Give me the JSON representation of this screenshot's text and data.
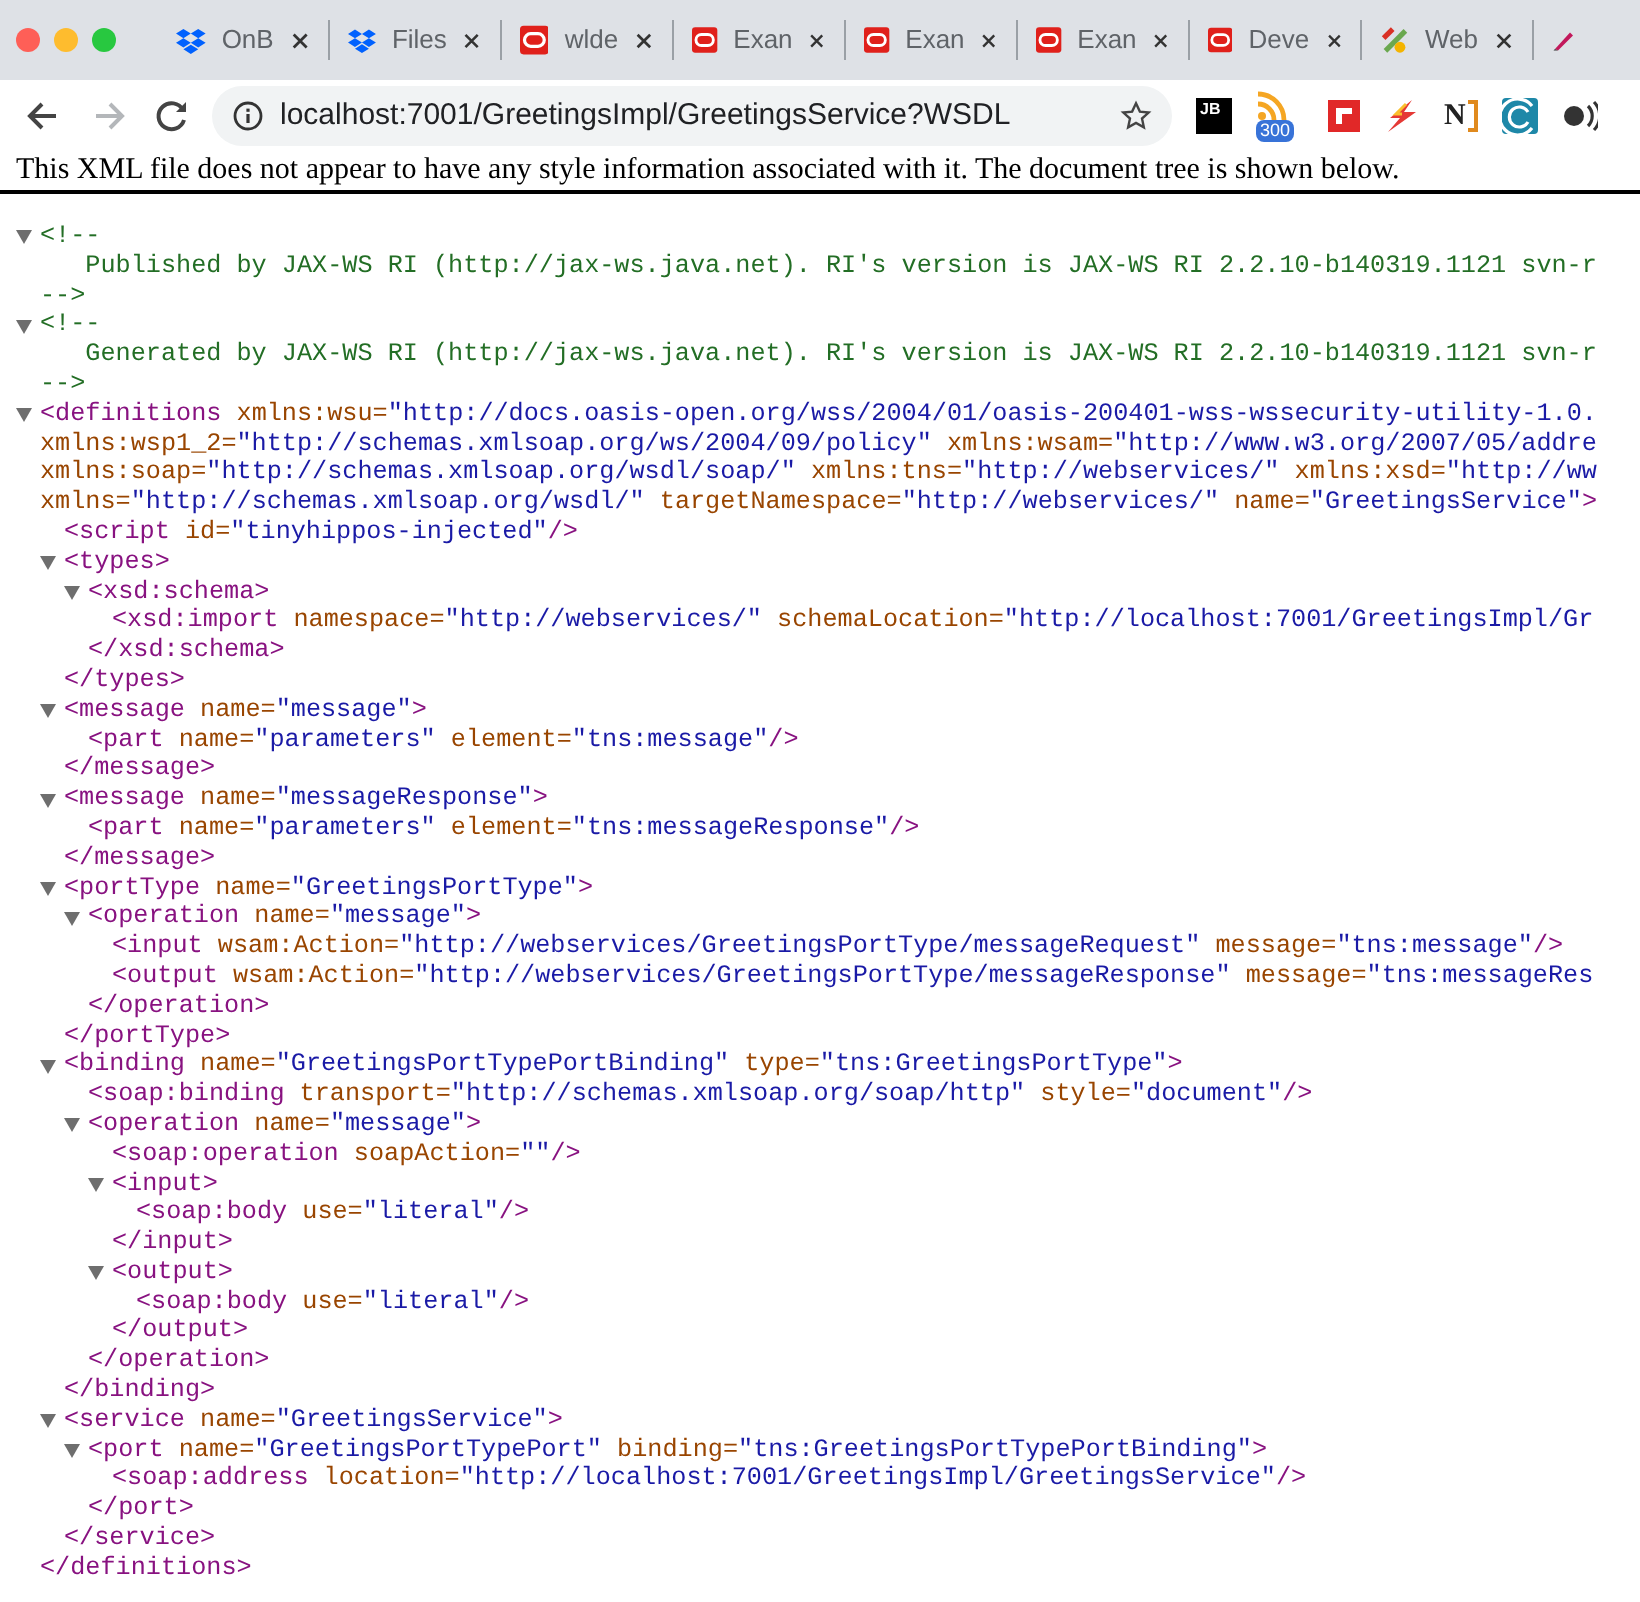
{
  "tabs": [
    {
      "kind": "dropbox",
      "title": "OnB",
      "selected": false
    },
    {
      "kind": "dropbox",
      "title": "Files",
      "selected": false
    },
    {
      "kind": "oracle",
      "title": "wlde",
      "selected": false
    },
    {
      "kind": "oracle",
      "title": "Exan",
      "selected": false
    },
    {
      "kind": "oracle",
      "title": "Exan",
      "selected": false
    },
    {
      "kind": "oracle",
      "title": "Exan",
      "selected": false
    },
    {
      "kind": "oracle",
      "title": "Deve",
      "selected": false
    },
    {
      "kind": "palette",
      "title": "Web",
      "selected": false
    },
    {
      "kind": "pen",
      "selected": false
    }
  ],
  "toolbar": {
    "buttons": [
      {
        "kind": "back",
        "disabled": false
      },
      {
        "kind": "forward",
        "disabled": true
      },
      {
        "kind": "reload",
        "disabled": false
      }
    ],
    "url": "localhost:7001/GreetingsImpl/GreetingsService?WSDL",
    "extensions": [
      {
        "kind": "jb",
        "label": "JB"
      },
      {
        "kind": "rss",
        "badge": "300"
      },
      {
        "kind": "flipboard"
      },
      {
        "kind": "bolt"
      },
      {
        "kind": "n",
        "label": "N"
      },
      {
        "kind": "wave"
      },
      {
        "kind": "broadcast"
      }
    ]
  },
  "info": "This XML file does not appear to have any style information associated with it. The document tree is shown below.",
  "document": [
    {
      "kind": "comment",
      "expanded": true,
      "lines": [
        "<!--",
        "   Published by JAX-WS RI (http://jax-ws.java.net). RI's version is JAX-WS RI 2.2.10-b140319.1121 svn-r",
        "-->"
      ]
    },
    {
      "kind": "comment",
      "expanded": true,
      "lines": [
        "<!--",
        "   Generated by JAX-WS RI (http://jax-ws.java.net). RI's version is JAX-WS RI 2.2.10-b140319.1121 svn-r",
        "-->"
      ]
    },
    {
      "kind": "element",
      "expanded": true,
      "open": [
        [
          {
            "kind": "tag",
            "text": "<definitions"
          },
          {
            "kind": "attr",
            "text": " xmlns:wsu="
          },
          {
            "kind": "value",
            "text": "\"http://docs.oasis-open.org/wss/2004/01/oasis-200401-wss-wssecurity-utility-1.0."
          }
        ],
        [
          {
            "kind": "attr",
            "text": "xmlns:wsp1_2="
          },
          {
            "kind": "value",
            "text": "\"http://schemas.xmlsoap.org/ws/2004/09/policy\""
          },
          {
            "kind": "attr",
            "text": " xmlns:wsam="
          },
          {
            "kind": "value",
            "text": "\"http://www.w3.org/2007/05/addre"
          }
        ],
        [
          {
            "kind": "attr",
            "text": "xmlns:soap="
          },
          {
            "kind": "value",
            "text": "\"http://schemas.xmlsoap.org/wsdl/soap/\""
          },
          {
            "kind": "attr",
            "text": " xmlns:tns="
          },
          {
            "kind": "value",
            "text": "\"http://webservices/\""
          },
          {
            "kind": "attr",
            "text": " xmlns:xsd="
          },
          {
            "kind": "value",
            "text": "\"http://ww"
          }
        ],
        [
          {
            "kind": "attr",
            "text": "xmlns="
          },
          {
            "kind": "value",
            "text": "\"http://schemas.xmlsoap.org/wsdl/\""
          },
          {
            "kind": "attr",
            "text": " targetNamespace="
          },
          {
            "kind": "value",
            "text": "\"http://webservices/\""
          },
          {
            "kind": "attr",
            "text": " name="
          },
          {
            "kind": "value",
            "text": "\"GreetingsService\""
          },
          {
            "kind": "tag",
            "text": ">"
          }
        ]
      ],
      "children": [
        {
          "kind": "element",
          "open": [
            [
              {
                "kind": "tag",
                "text": "<script"
              },
              {
                "kind": "attr",
                "text": " id="
              },
              {
                "kind": "value",
                "text": "\"tinyhippos-injected\""
              },
              {
                "kind": "tag",
                "text": "/>"
              }
            ]
          ]
        },
        {
          "kind": "element",
          "expanded": true,
          "open": [
            [
              {
                "kind": "tag",
                "text": "<types>"
              }
            ]
          ],
          "children": [
            {
              "kind": "element",
              "expanded": true,
              "open": [
                [
                  {
                    "kind": "tag",
                    "text": "<xsd:schema>"
                  }
                ]
              ],
              "children": [
                {
                  "kind": "element",
                  "open": [
                    [
                      {
                        "kind": "tag",
                        "text": "<xsd:import"
                      },
                      {
                        "kind": "attr",
                        "text": " namespace="
                      },
                      {
                        "kind": "value",
                        "text": "\"http://webservices/\""
                      },
                      {
                        "kind": "attr",
                        "text": " schemaLocation="
                      },
                      {
                        "kind": "value",
                        "text": "\"http://localhost:7001/GreetingsImpl/Gr"
                      }
                    ]
                  ]
                }
              ],
              "close": [
                {
                  "kind": "tag",
                  "text": "</xsd:schema>"
                }
              ]
            }
          ],
          "close": [
            {
              "kind": "tag",
              "text": "</types>"
            }
          ]
        },
        {
          "kind": "element",
          "expanded": true,
          "open": [
            [
              {
                "kind": "tag",
                "text": "<message"
              },
              {
                "kind": "attr",
                "text": " name="
              },
              {
                "kind": "value",
                "text": "\"message\""
              },
              {
                "kind": "tag",
                "text": ">"
              }
            ]
          ],
          "children": [
            {
              "kind": "element",
              "open": [
                [
                  {
                    "kind": "tag",
                    "text": "<part"
                  },
                  {
                    "kind": "attr",
                    "text": " name="
                  },
                  {
                    "kind": "value",
                    "text": "\"parameters\""
                  },
                  {
                    "kind": "attr",
                    "text": " element="
                  },
                  {
                    "kind": "value",
                    "text": "\"tns:message\""
                  },
                  {
                    "kind": "tag",
                    "text": "/>"
                  }
                ]
              ]
            }
          ],
          "close": [
            {
              "kind": "tag",
              "text": "</message>"
            }
          ]
        },
        {
          "kind": "element",
          "expanded": true,
          "open": [
            [
              {
                "kind": "tag",
                "text": "<message"
              },
              {
                "kind": "attr",
                "text": " name="
              },
              {
                "kind": "value",
                "text": "\"messageResponse\""
              },
              {
                "kind": "tag",
                "text": ">"
              }
            ]
          ],
          "children": [
            {
              "kind": "element",
              "open": [
                [
                  {
                    "kind": "tag",
                    "text": "<part"
                  },
                  {
                    "kind": "attr",
                    "text": " name="
                  },
                  {
                    "kind": "value",
                    "text": "\"parameters\""
                  },
                  {
                    "kind": "attr",
                    "text": " element="
                  },
                  {
                    "kind": "value",
                    "text": "\"tns:messageResponse\""
                  },
                  {
                    "kind": "tag",
                    "text": "/>"
                  }
                ]
              ]
            }
          ],
          "close": [
            {
              "kind": "tag",
              "text": "</message>"
            }
          ]
        },
        {
          "kind": "element",
          "expanded": true,
          "open": [
            [
              {
                "kind": "tag",
                "text": "<portType"
              },
              {
                "kind": "attr",
                "text": " name="
              },
              {
                "kind": "value",
                "text": "\"GreetingsPortType\""
              },
              {
                "kind": "tag",
                "text": ">"
              }
            ]
          ],
          "children": [
            {
              "kind": "element",
              "expanded": true,
              "open": [
                [
                  {
                    "kind": "tag",
                    "text": "<operation"
                  },
                  {
                    "kind": "attr",
                    "text": " name="
                  },
                  {
                    "kind": "value",
                    "text": "\"message\""
                  },
                  {
                    "kind": "tag",
                    "text": ">"
                  }
                ]
              ],
              "children": [
                {
                  "kind": "element",
                  "open": [
                    [
                      {
                        "kind": "tag",
                        "text": "<input"
                      },
                      {
                        "kind": "attr",
                        "text": " wsam:Action="
                      },
                      {
                        "kind": "value",
                        "text": "\"http://webservices/GreetingsPortType/messageRequest\""
                      },
                      {
                        "kind": "attr",
                        "text": " message="
                      },
                      {
                        "kind": "value",
                        "text": "\"tns:message\""
                      },
                      {
                        "kind": "tag",
                        "text": "/>"
                      }
                    ]
                  ]
                },
                {
                  "kind": "element",
                  "open": [
                    [
                      {
                        "kind": "tag",
                        "text": "<output"
                      },
                      {
                        "kind": "attr",
                        "text": " wsam:Action="
                      },
                      {
                        "kind": "value",
                        "text": "\"http://webservices/GreetingsPortType/messageResponse\""
                      },
                      {
                        "kind": "attr",
                        "text": " message="
                      },
                      {
                        "kind": "value",
                        "text": "\"tns:messageRes"
                      }
                    ]
                  ]
                }
              ],
              "close": [
                {
                  "kind": "tag",
                  "text": "</operation>"
                }
              ]
            }
          ],
          "close": [
            {
              "kind": "tag",
              "text": "</portType>"
            }
          ]
        },
        {
          "kind": "element",
          "expanded": true,
          "open": [
            [
              {
                "kind": "tag",
                "text": "<binding"
              },
              {
                "kind": "attr",
                "text": " name="
              },
              {
                "kind": "value",
                "text": "\"GreetingsPortTypePortBinding\""
              },
              {
                "kind": "attr",
                "text": " type="
              },
              {
                "kind": "value",
                "text": "\"tns:GreetingsPortType\""
              },
              {
                "kind": "tag",
                "text": ">"
              }
            ]
          ],
          "children": [
            {
              "kind": "element",
              "open": [
                [
                  {
                    "kind": "tag",
                    "text": "<soap:binding"
                  },
                  {
                    "kind": "attr",
                    "text": " transport="
                  },
                  {
                    "kind": "value",
                    "text": "\"http://schemas.xmlsoap.org/soap/http\""
                  },
                  {
                    "kind": "attr",
                    "text": " style="
                  },
                  {
                    "kind": "value",
                    "text": "\"document\""
                  },
                  {
                    "kind": "tag",
                    "text": "/>"
                  }
                ]
              ]
            },
            {
              "kind": "element",
              "expanded": true,
              "open": [
                [
                  {
                    "kind": "tag",
                    "text": "<operation"
                  },
                  {
                    "kind": "attr",
                    "text": " name="
                  },
                  {
                    "kind": "value",
                    "text": "\"message\""
                  },
                  {
                    "kind": "tag",
                    "text": ">"
                  }
                ]
              ],
              "children": [
                {
                  "kind": "element",
                  "open": [
                    [
                      {
                        "kind": "tag",
                        "text": "<soap:operation"
                      },
                      {
                        "kind": "attr",
                        "text": " soapAction="
                      },
                      {
                        "kind": "value",
                        "text": "\"\""
                      },
                      {
                        "kind": "tag",
                        "text": "/>"
                      }
                    ]
                  ]
                },
                {
                  "kind": "element",
                  "expanded": true,
                  "open": [
                    [
                      {
                        "kind": "tag",
                        "text": "<input>"
                      }
                    ]
                  ],
                  "children": [
                    {
                      "kind": "element",
                      "open": [
                        [
                          {
                            "kind": "tag",
                            "text": "<soap:body"
                          },
                          {
                            "kind": "attr",
                            "text": " use="
                          },
                          {
                            "kind": "value",
                            "text": "\"literal\""
                          },
                          {
                            "kind": "tag",
                            "text": "/>"
                          }
                        ]
                      ]
                    }
                  ],
                  "close": [
                    {
                      "kind": "tag",
                      "text": "</input>"
                    }
                  ]
                },
                {
                  "kind": "element",
                  "expanded": true,
                  "open": [
                    [
                      {
                        "kind": "tag",
                        "text": "<output>"
                      }
                    ]
                  ],
                  "children": [
                    {
                      "kind": "element",
                      "open": [
                        [
                          {
                            "kind": "tag",
                            "text": "<soap:body"
                          },
                          {
                            "kind": "attr",
                            "text": " use="
                          },
                          {
                            "kind": "value",
                            "text": "\"literal\""
                          },
                          {
                            "kind": "tag",
                            "text": "/>"
                          }
                        ]
                      ]
                    }
                  ],
                  "close": [
                    {
                      "kind": "tag",
                      "text": "</output>"
                    }
                  ]
                }
              ],
              "close": [
                {
                  "kind": "tag",
                  "text": "</operation>"
                }
              ]
            }
          ],
          "close": [
            {
              "kind": "tag",
              "text": "</binding>"
            }
          ]
        },
        {
          "kind": "element",
          "expanded": true,
          "open": [
            [
              {
                "kind": "tag",
                "text": "<service"
              },
              {
                "kind": "attr",
                "text": " name="
              },
              {
                "kind": "value",
                "text": "\"GreetingsService\""
              },
              {
                "kind": "tag",
                "text": ">"
              }
            ]
          ],
          "children": [
            {
              "kind": "element",
              "expanded": true,
              "open": [
                [
                  {
                    "kind": "tag",
                    "text": "<port"
                  },
                  {
                    "kind": "attr",
                    "text": " name="
                  },
                  {
                    "kind": "value",
                    "text": "\"GreetingsPortTypePort\""
                  },
                  {
                    "kind": "attr",
                    "text": " binding="
                  },
                  {
                    "kind": "value",
                    "text": "\"tns:GreetingsPortTypePortBinding\""
                  },
                  {
                    "kind": "tag",
                    "text": ">"
                  }
                ]
              ],
              "children": [
                {
                  "kind": "element",
                  "open": [
                    [
                      {
                        "kind": "tag",
                        "text": "<soap:address"
                      },
                      {
                        "kind": "attr",
                        "text": " location="
                      },
                      {
                        "kind": "value",
                        "text": "\"http://localhost:7001/GreetingsImpl/GreetingsService\""
                      },
                      {
                        "kind": "tag",
                        "text": "/>"
                      }
                    ]
                  ]
                }
              ],
              "close": [
                {
                  "kind": "tag",
                  "text": "</port>"
                }
              ]
            }
          ],
          "close": [
            {
              "kind": "tag",
              "text": "</service>"
            }
          ]
        }
      ],
      "close": [
        {
          "kind": "tag",
          "text": "</definitions>"
        }
      ]
    }
  ]
}
